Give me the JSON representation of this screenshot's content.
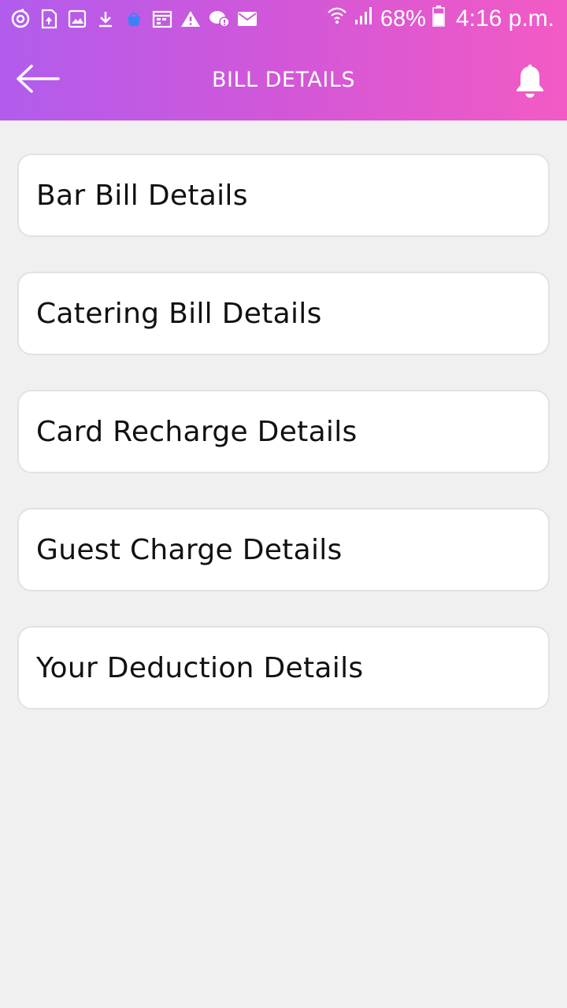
{
  "status_bar": {
    "battery_percent": "68%",
    "time": "4:16 p.m.",
    "icons_left": [
      "sync-icon",
      "sim-update-icon",
      "gallery-icon",
      "download-icon",
      "bag-icon",
      "calendar-icon",
      "warning-icon",
      "chat-alert-icon",
      "mail-icon"
    ],
    "icons_right": [
      "wifi-icon",
      "signal-icon",
      "battery-icon"
    ]
  },
  "header": {
    "title": "BILL DETAILS",
    "back_icon": "arrow-left-icon",
    "notification_icon": "bell-icon",
    "gradient": [
      "#b15ced",
      "#f35ac4"
    ]
  },
  "menu": {
    "items": [
      {
        "label": "Bar Bill Details"
      },
      {
        "label": "Catering Bill Details"
      },
      {
        "label": "Card Recharge Details"
      },
      {
        "label": "Guest Charge Details"
      },
      {
        "label": "Your Deduction Details"
      }
    ]
  },
  "colors": {
    "background": "#f0f0f0",
    "card": "#ffffff",
    "text": "#111111",
    "accent_blue": "#3b82f6"
  }
}
